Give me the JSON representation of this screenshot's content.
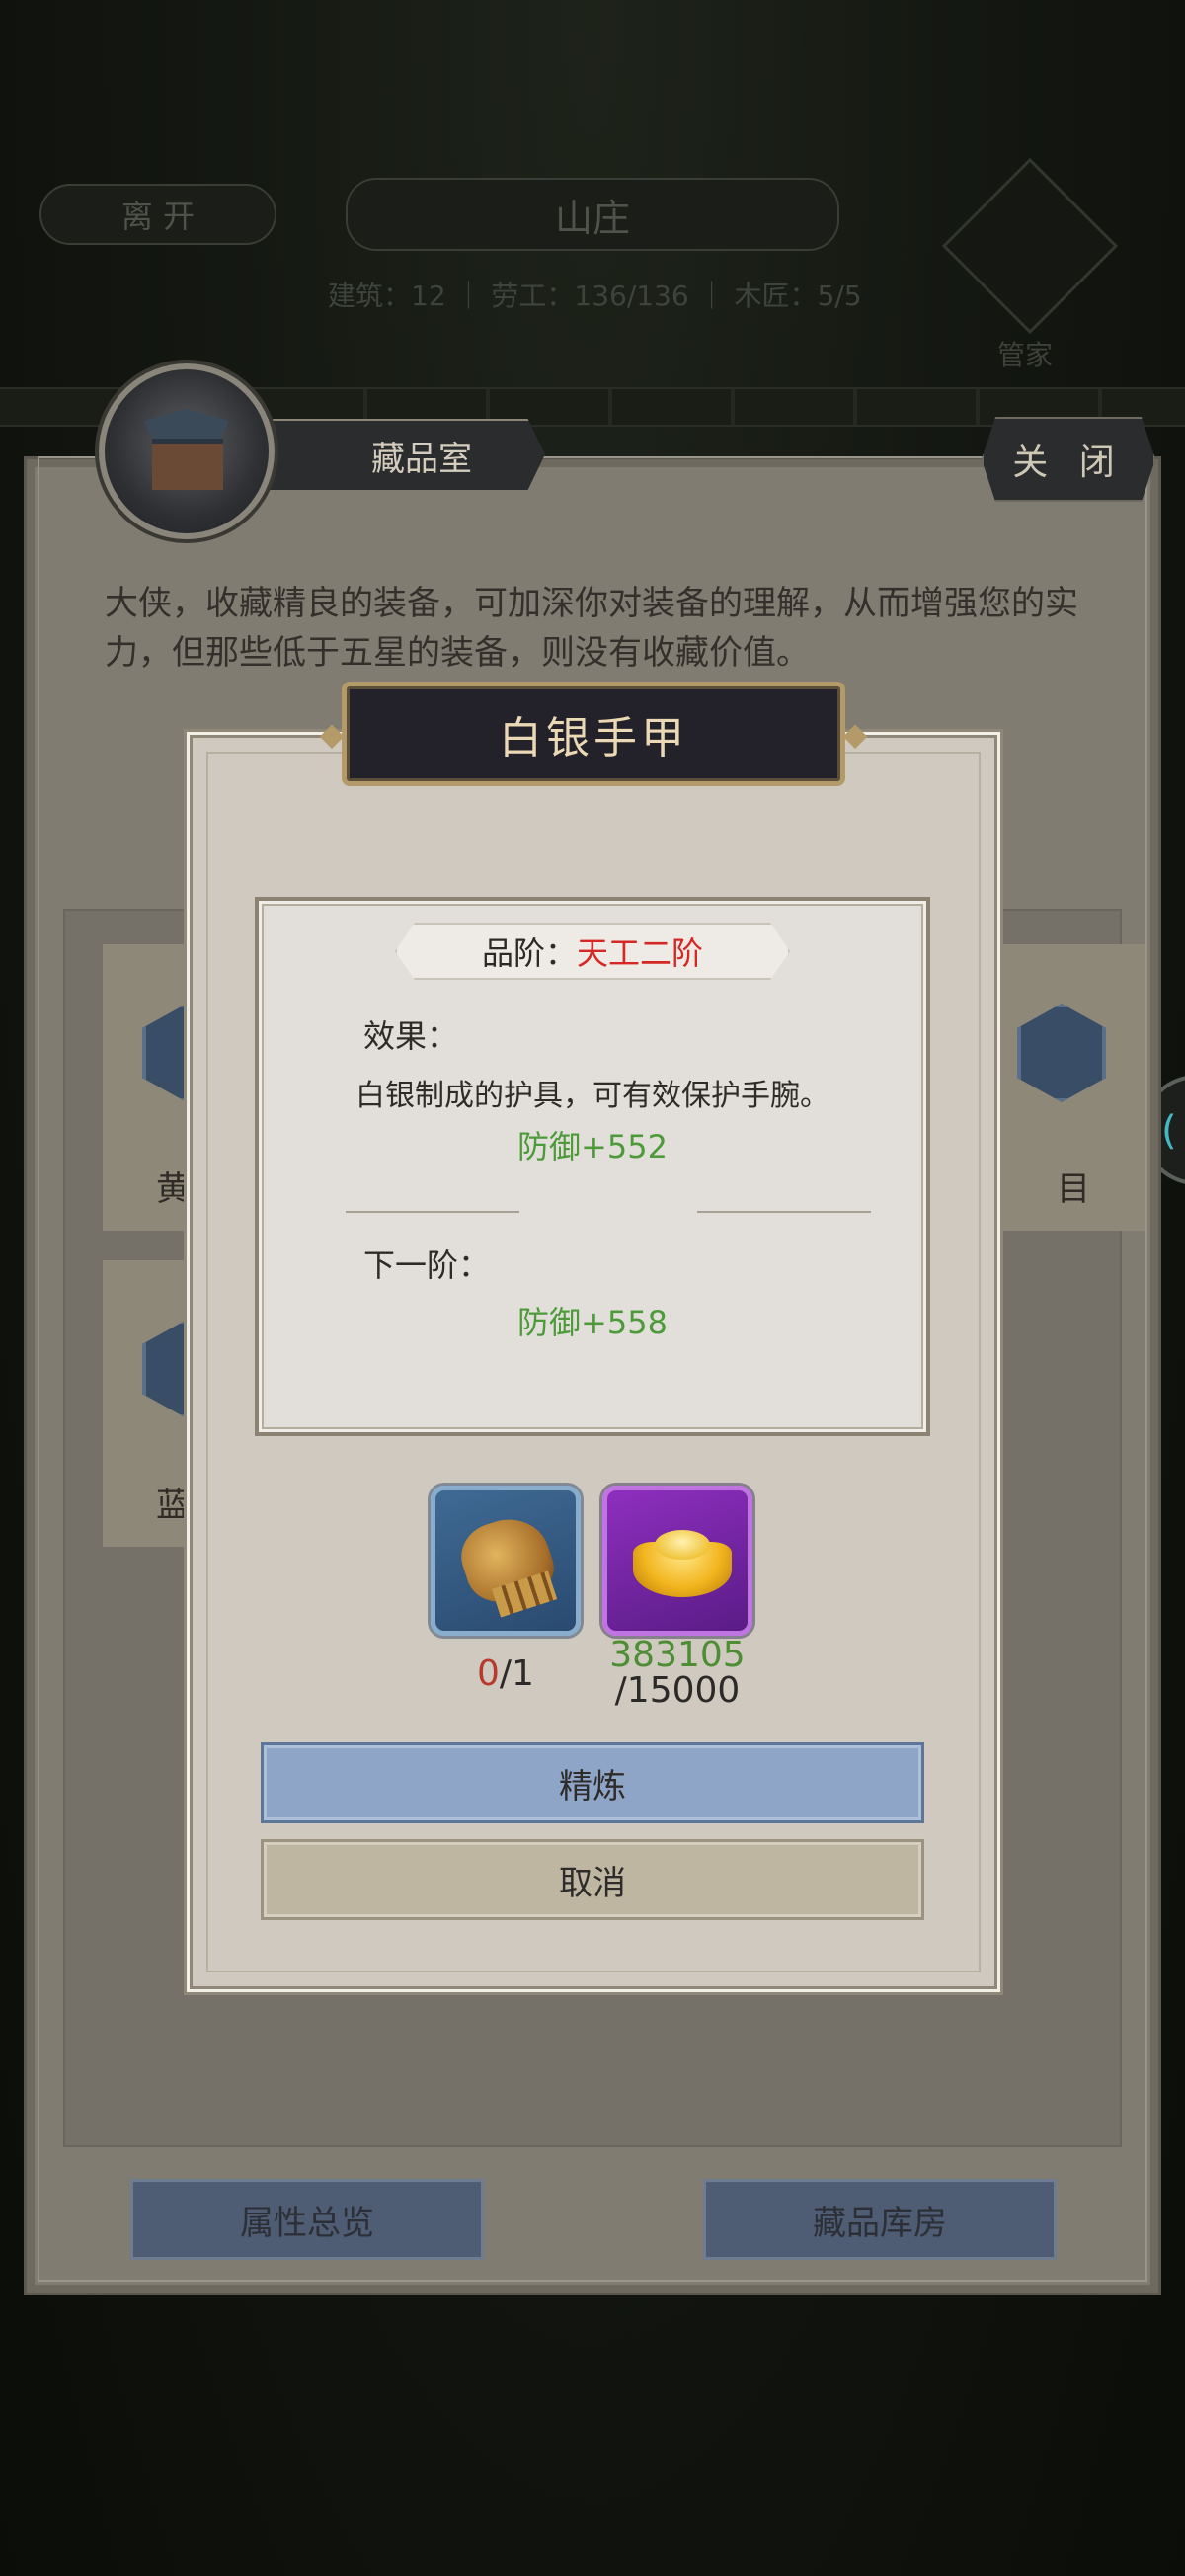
{
  "background": {
    "leave_button": "离 开",
    "location_title": "山庄",
    "stats": "建筑：12 ｜ 劳工：136/136 ｜ 木匠：5/5",
    "manager_label": "管家"
  },
  "room": {
    "title": "藏品室",
    "close_label": "关 闭",
    "description": "大侠，收藏精良的装备，可加深你对装备的理解，从而增强您的实力，但那些低于五星的装备，则没有收藏价值。",
    "card_labels": [
      "黄",
      "目",
      "蓝"
    ],
    "overview_button": "属性总览",
    "storage_button": "藏品库房"
  },
  "dialog": {
    "item_name": "白银手甲",
    "grade_label": "品阶：",
    "grade_value": "天工二阶",
    "effect_label": "效果：",
    "effect_desc": "白银制成的护具，可有效保护手腕。",
    "current_stat": "防御+552",
    "next_label": "下一阶：",
    "next_stat": "防御+558",
    "material_gauntlet": {
      "have": "0",
      "need": "/1",
      "icon": "gauntlet-icon"
    },
    "material_gold": {
      "have": "383105",
      "need": "/15000",
      "icon": "gold-ingot-icon"
    },
    "refine_label": "精炼",
    "cancel_label": "取消"
  },
  "colors": {
    "grade_red": "#d52724",
    "stat_green": "#4d9a3a",
    "refine_blue": "#8ea5c7",
    "title_gold": "#ead9b4"
  }
}
